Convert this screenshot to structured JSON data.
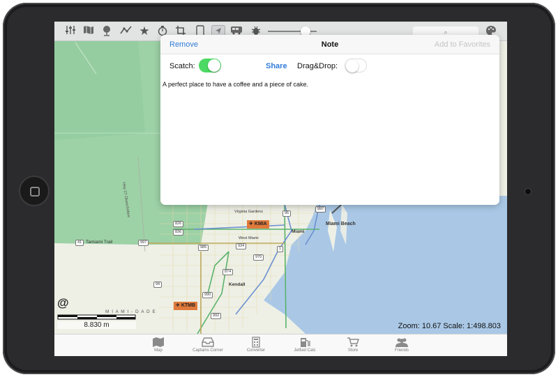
{
  "toolbar": {
    "icons": [
      "sliders-icon",
      "map-icon",
      "globe-icon",
      "route-icon",
      "star-icon",
      "stopwatch-icon",
      "crop-icon",
      "tablet-icon",
      "navigate-icon",
      "bus-icon",
      "bug-icon",
      "palette-icon"
    ]
  },
  "note_panel": {
    "remove_label": "Remove",
    "title": "Note",
    "favorites_label": "Add to Favorites",
    "scatch_label": "Scatch:",
    "scatch_on": true,
    "share_label": "Share",
    "dragdrop_label": "Drag&Drop:",
    "dragdrop_on": false,
    "text": "A perfect place to have a coffee and a piece of cake."
  },
  "map": {
    "labels": {
      "miami_beach": "Miami Beach",
      "miami": "Miami",
      "kendall": "Kendall",
      "tamiami": "Tamiami Trail",
      "miami_dade": "M I A M I - D A D E",
      "us27": "Hwy 27 Okeechobee",
      "virginia": "Virginia Gardens",
      "west_miami": "West Miami"
    },
    "airports": {
      "kmia": "KMIA",
      "ktmb": "KTMB"
    },
    "shields": {
      "s41": "41",
      "s997a": "997",
      "s997b": "997",
      "s826": "826",
      "s836": "836",
      "s985": "985",
      "s874": "874",
      "s94": "94",
      "s990": "990",
      "s992": "992",
      "s1": "1",
      "s95": "95",
      "s967": "967",
      "s934": "934",
      "s970": "970"
    },
    "attribution_symbol": "@",
    "scale_label": "8.830 m",
    "status": "Zoom: 10.67  Scale: 1:498.803"
  },
  "tabs": [
    {
      "label": "Map",
      "icon": "map-icon"
    },
    {
      "label": "Captains Corner",
      "icon": "tray-icon"
    },
    {
      "label": "Converter",
      "icon": "calculator-icon"
    },
    {
      "label": "Jetfuel Calc",
      "icon": "fuel-pump-icon"
    },
    {
      "label": "Store",
      "icon": "cart-icon"
    },
    {
      "label": "Friends",
      "icon": "friends-icon"
    }
  ],
  "colors": {
    "accent": "#2f7bd9",
    "toggle_on": "#4cd964",
    "airport": "#e07a3c",
    "water": "#aac8e6",
    "land": "#eef0e6",
    "park": "#9dd1a6"
  }
}
